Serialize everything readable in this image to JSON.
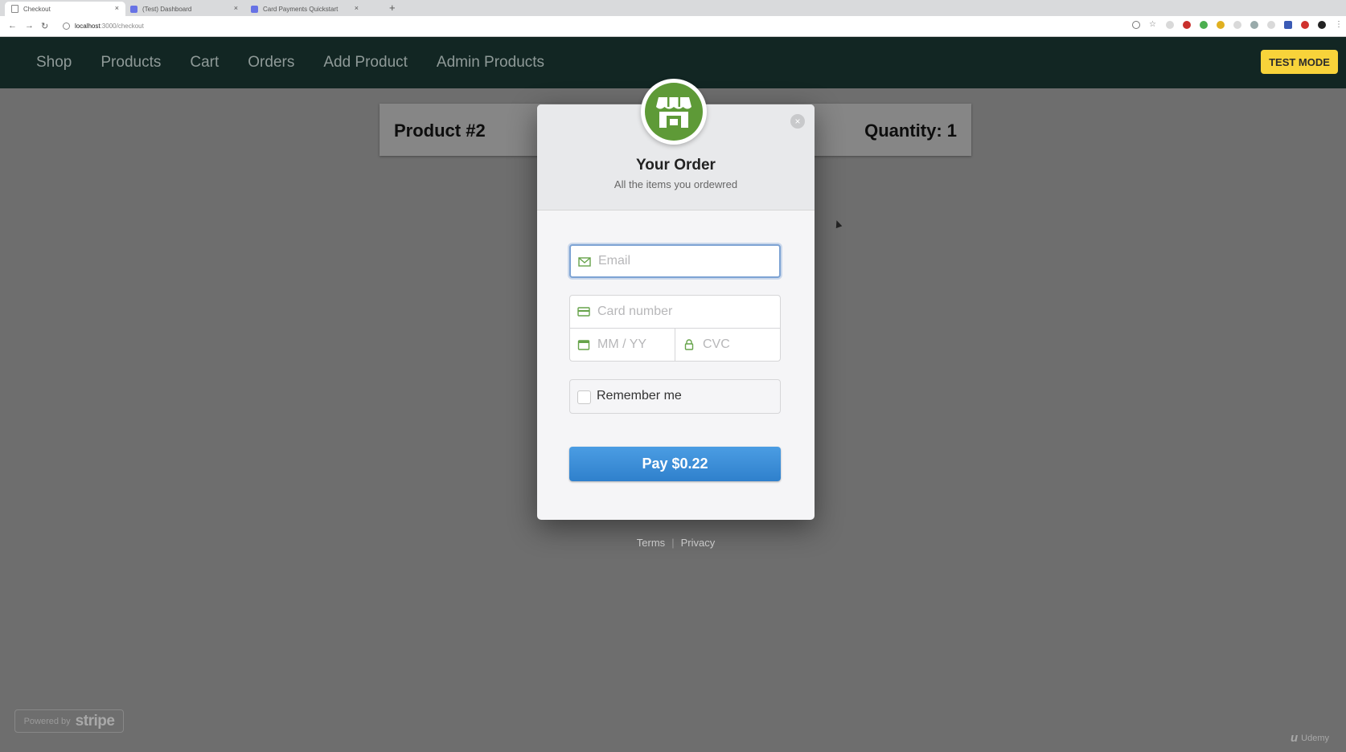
{
  "browser": {
    "tabs": [
      {
        "label": "Checkout",
        "active": true
      },
      {
        "label": "(Test) Dashboard",
        "active": false
      },
      {
        "label": "Card Payments Quickstart",
        "active": false
      }
    ],
    "tab_close": "×",
    "new_tab": "+",
    "nav": {
      "back": "←",
      "forward": "→",
      "reload": "↻"
    },
    "url_host": "localhost",
    "url_path": ":3000/checkout"
  },
  "navbar": {
    "links": [
      "Shop",
      "Products",
      "Cart",
      "Orders",
      "Add Product",
      "Admin Products"
    ]
  },
  "test_mode": "TEST MODE",
  "product": {
    "title": "Product #2",
    "quantity": "Quantity: 1"
  },
  "checkout": {
    "title": "Your Order",
    "subtitle": "All the items you ordewred",
    "close": "×",
    "email_placeholder": "Email",
    "card_placeholder": "Card number",
    "expiry_placeholder": "MM / YY",
    "cvc_placeholder": "CVC",
    "remember_label": "Remember me",
    "pay_button": "Pay $0.22",
    "footer": {
      "terms": "Terms",
      "privacy": "Privacy",
      "separator": "|"
    }
  },
  "powered_by": {
    "prefix": "Powered by",
    "brand": "stripe"
  },
  "watermark": "Udemy",
  "colors": {
    "navbar_bg": "#122623",
    "logo_green": "#5e9a37",
    "pay_blue": "#3b8ede",
    "test_mode_yellow": "#f8d33a"
  }
}
